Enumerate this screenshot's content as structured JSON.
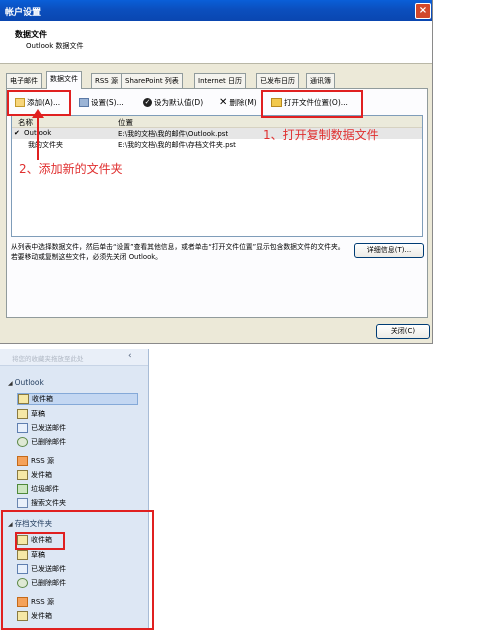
{
  "dialog": {
    "title": "帐户设置",
    "close_glyph": "×",
    "header_title": "数据文件",
    "header_subtitle": "Outlook 数据文件",
    "tabs": [
      "电子邮件",
      "数据文件",
      "RSS 源",
      "SharePoint 列表",
      "Internet 日历",
      "已发布日历",
      "通讯簿"
    ],
    "toolbar": {
      "add": "添加(A)...",
      "settings": "设置(S)...",
      "set_default": "设为默认值(D)",
      "remove": "删除(M)",
      "open_location": "打开文件位置(O)..."
    },
    "list_headers": {
      "name": "名称",
      "location": "位置"
    },
    "rows": [
      {
        "name": "Outlook",
        "location": "E:\\我的文档\\我的邮件\\Outlook.pst"
      },
      {
        "name": "我的文件夹",
        "location": "E:\\我的文档\\我的邮件\\存档文件夹.pst"
      }
    ],
    "description": "从列表中选择数据文件，然后单击“设置”查看其他信息，或者单击“打开文件位置”显示包含数据文件的文件夹。若要移动或复制这些文件，必须先关闭 Outlook。",
    "details_button": "详细信息(T)...",
    "close_button": "关闭(C)"
  },
  "annotations": {
    "step1": "1、打开复制数据文件",
    "step2": "2、添加新的文件夹",
    "color": "#e03030"
  },
  "nav": {
    "hint": "将您的收藏夹拖放至此处",
    "collapse_glyph": "‹",
    "group1": {
      "label": "Outlook",
      "items": [
        "收件箱",
        "草稿",
        "已发送邮件",
        "已删除邮件",
        "RSS 源",
        "发件箱",
        "垃圾邮件",
        "搜索文件夹"
      ]
    },
    "group2": {
      "label": "存档文件夹",
      "items": [
        "收件箱",
        "草稿",
        "已发送邮件",
        "已删除邮件",
        "RSS 源",
        "发件箱"
      ]
    }
  }
}
